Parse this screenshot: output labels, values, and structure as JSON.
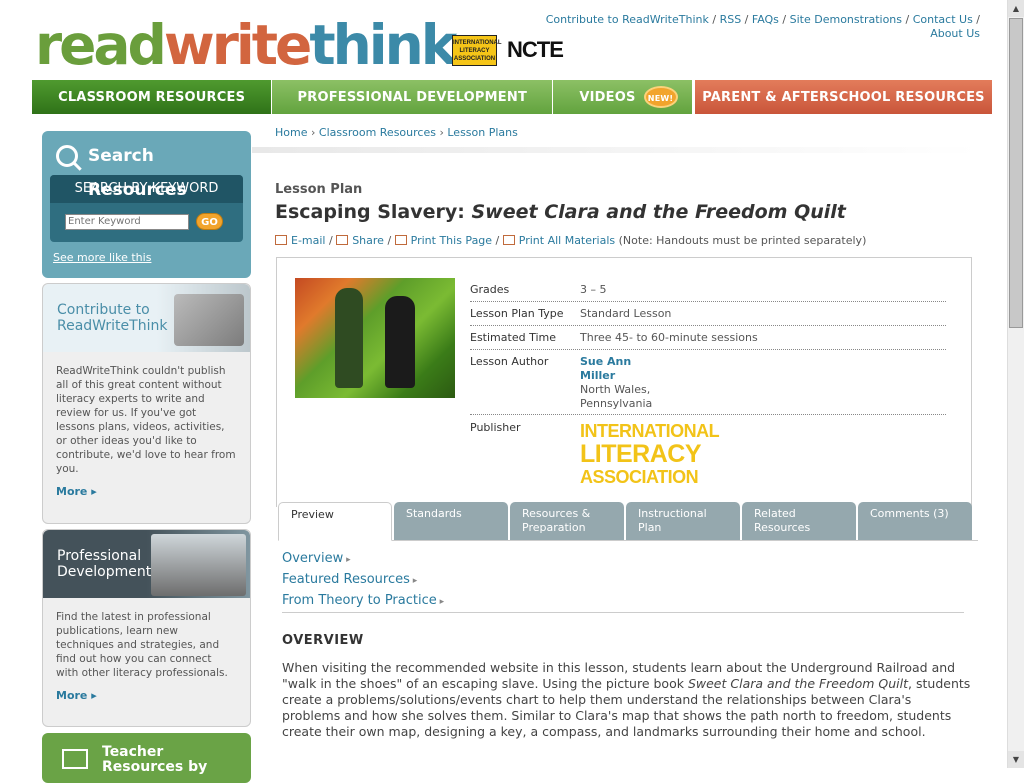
{
  "header": {
    "logo": {
      "read": "read",
      "write": "write",
      "think": "think"
    },
    "ila_badge": "INTERNATIONAL LITERACY ASSOCIATION",
    "ncte": "NCTE",
    "top_links": [
      "Contribute to ReadWriteThink",
      "RSS",
      "FAQs",
      "Site Demonstrations",
      "Contact Us",
      "About Us"
    ]
  },
  "nav": {
    "classroom": "CLASSROOM RESOURCES",
    "professional": "PROFESSIONAL DEVELOPMENT",
    "videos": "VIDEOS",
    "videos_badge": "NEW!",
    "parent": "PARENT & AFTERSCHOOL RESOURCES"
  },
  "sidebar": {
    "search_title": "Search Resources",
    "keyword_heading": "SEARCH BY KEYWORD",
    "keyword_placeholder": "Enter Keyword",
    "go": "GO",
    "see_more": "See more like this",
    "contribute_title_1": "Contribute to",
    "contribute_title_2": "ReadWriteThink",
    "contribute_text": "ReadWriteThink couldn't publish all of this great content without literacy experts to write and review for us. If you've got lessons plans, videos, activities, or other ideas you'd like to contribute, we'd love to hear from you.",
    "contribute_more": "More",
    "prof_title_1": "Professional",
    "prof_title_2": "Development",
    "prof_text": "Find the latest in professional publications, learn new techniques and strategies, and find out how you can connect with other literacy professionals.",
    "prof_more": "More",
    "teacher_title_1": "Teacher",
    "teacher_title_2": "Resources by"
  },
  "breadcrumb": [
    "Home",
    "Classroom Resources",
    "Lesson Plans"
  ],
  "lesson": {
    "type": "Lesson Plan",
    "title_prefix": "Escaping Slavery: ",
    "title_book": "Sweet Clara and the Freedom Quilt",
    "actions": {
      "email": "E-mail",
      "share": "Share",
      "print_page": "Print This Page",
      "print_all": "Print All Materials",
      "note": "(Note: Handouts must be printed separately)"
    },
    "info": {
      "grades_label": "Grades",
      "grades": "3 – 5",
      "type_label": "Lesson Plan Type",
      "type": "Standard Lesson",
      "time_label": "Estimated Time",
      "time": "Three 45- to 60-minute sessions",
      "author_label": "Lesson Author",
      "author_first": "Sue Ann",
      "author_last": "Miller",
      "location_1": "North Wales,",
      "location_2": "Pennsylvania",
      "publisher_label": "Publisher",
      "publisher_1": "INTERNATIONAL",
      "publisher_2": "LITERACY",
      "publisher_3": "ASSOCIATION"
    }
  },
  "tabs": [
    {
      "l1": "Preview",
      "l2": ""
    },
    {
      "l1": "Standards",
      "l2": ""
    },
    {
      "l1": "Resources &",
      "l2": "Preparation"
    },
    {
      "l1": "Instructional",
      "l2": "Plan"
    },
    {
      "l1": "Related",
      "l2": "Resources"
    },
    {
      "l1": "Comments (3)",
      "l2": ""
    }
  ],
  "subnav": [
    "Overview",
    "Featured Resources",
    "From Theory to Practice"
  ],
  "overview": {
    "heading": "OVERVIEW",
    "text_1": "When visiting the recommended website in this lesson, students learn about the Underground Railroad and \"walk in the shoes\" of an escaping slave. Using the picture book ",
    "text_book": "Sweet Clara and the Freedom Quilt",
    "text_2": ", students create a problems/solutions/events chart to help them understand the relationships between Clara's problems and how she solves them. Similar to Clara's map that shows the path north to freedom, students create their own map, designing a key, a compass, and landmarks surrounding their home and school."
  }
}
